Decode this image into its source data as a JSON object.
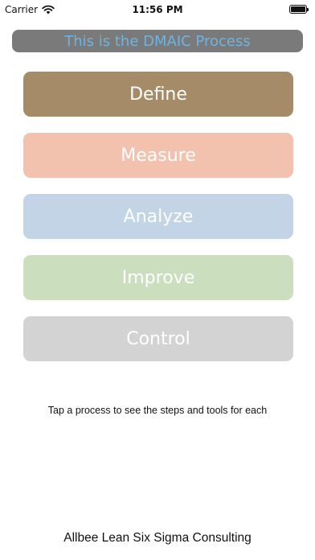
{
  "status_bar": {
    "carrier": "Carrier",
    "wifi_icon": "wifi-icon",
    "time": "11:56 PM",
    "battery_icon": "battery-icon",
    "battery_level": 1.0
  },
  "header": {
    "title": "This is the DMAIC Process",
    "background": "#7a7a7a",
    "text_color": "#6fb3e0"
  },
  "processes": [
    {
      "label": "Define",
      "color": "#a58b68"
    },
    {
      "label": "Measure",
      "color": "#f2c2ae"
    },
    {
      "label": "Analyze",
      "color": "#c2d4e6"
    },
    {
      "label": "Improve",
      "color": "#cbdfbf"
    },
    {
      "label": "Control",
      "color": "#d3d3d3"
    }
  ],
  "hint": "Tap a process to see the steps and tools for each",
  "footer": "Allbee Lean Six Sigma Consulting"
}
